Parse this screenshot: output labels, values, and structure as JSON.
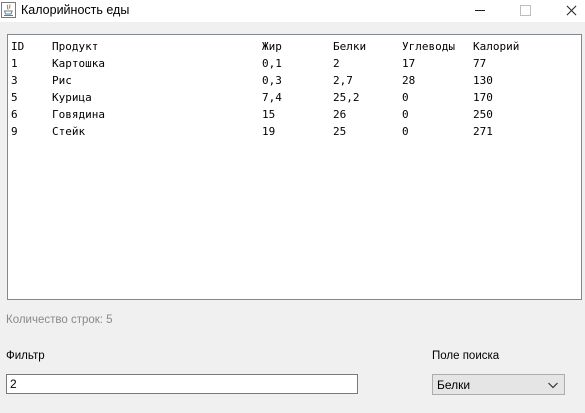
{
  "window": {
    "title": "Калорийность еды",
    "icon": "java-icon"
  },
  "table": {
    "headers": [
      "ID",
      "Продукт",
      "Жир",
      "Белки",
      "Углеводы",
      "Калорий"
    ],
    "rows": [
      [
        "1",
        "Картошка",
        "0,1",
        "2",
        "17",
        "77"
      ],
      [
        "3",
        "Рис",
        "0,3",
        "2,7",
        "28",
        "130"
      ],
      [
        "5",
        "Курица",
        "7,4",
        "25,2",
        "0",
        "170"
      ],
      [
        "6",
        "Говядина",
        "15",
        "26",
        "0",
        "250"
      ],
      [
        "9",
        "Стейк",
        "19",
        "25",
        "0",
        "271"
      ]
    ]
  },
  "status": {
    "row_count_text": "Количество строк: 5"
  },
  "filter": {
    "label": "Фильтр",
    "value": "2"
  },
  "search_field": {
    "label": "Поле поиска",
    "selected": "Белки"
  },
  "colors": {
    "background": "#f0f0f0",
    "table_border": "#828790",
    "status_text": "#8a8a8a"
  }
}
